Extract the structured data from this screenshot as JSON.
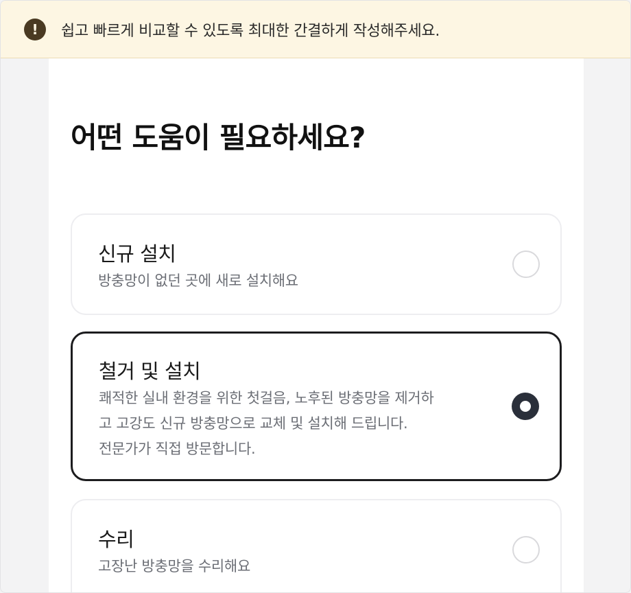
{
  "banner": {
    "icon": "exclamation-icon",
    "text": "쉽고 빠르게 비교할 수 있도록 최대한 간결하게 작성해주세요."
  },
  "page": {
    "title": "어떤 도움이 필요하세요?"
  },
  "options": [
    {
      "title": "신규 설치",
      "description_lines": [
        "방충망이 없던 곳에 새로 설치해요"
      ],
      "selected": false
    },
    {
      "title": "철거 및 설치",
      "description_lines": [
        "쾌적한 실내 환경을 위한 첫걸음, 노후된 방충망을 제거하",
        "고 고강도 신규 방충망으로 교체 및 설치해 드립니다.",
        "전문가가 직접 방문합니다."
      ],
      "selected": true
    },
    {
      "title": "수리",
      "description_lines": [
        "고장난 방충망을 수리해요"
      ],
      "selected": false
    }
  ],
  "colors": {
    "banner_bg": "#fdf6e3",
    "banner_icon": "#4a3a22",
    "selected_border": "#1c1c1e",
    "radio_on": "#2a2f3a"
  }
}
